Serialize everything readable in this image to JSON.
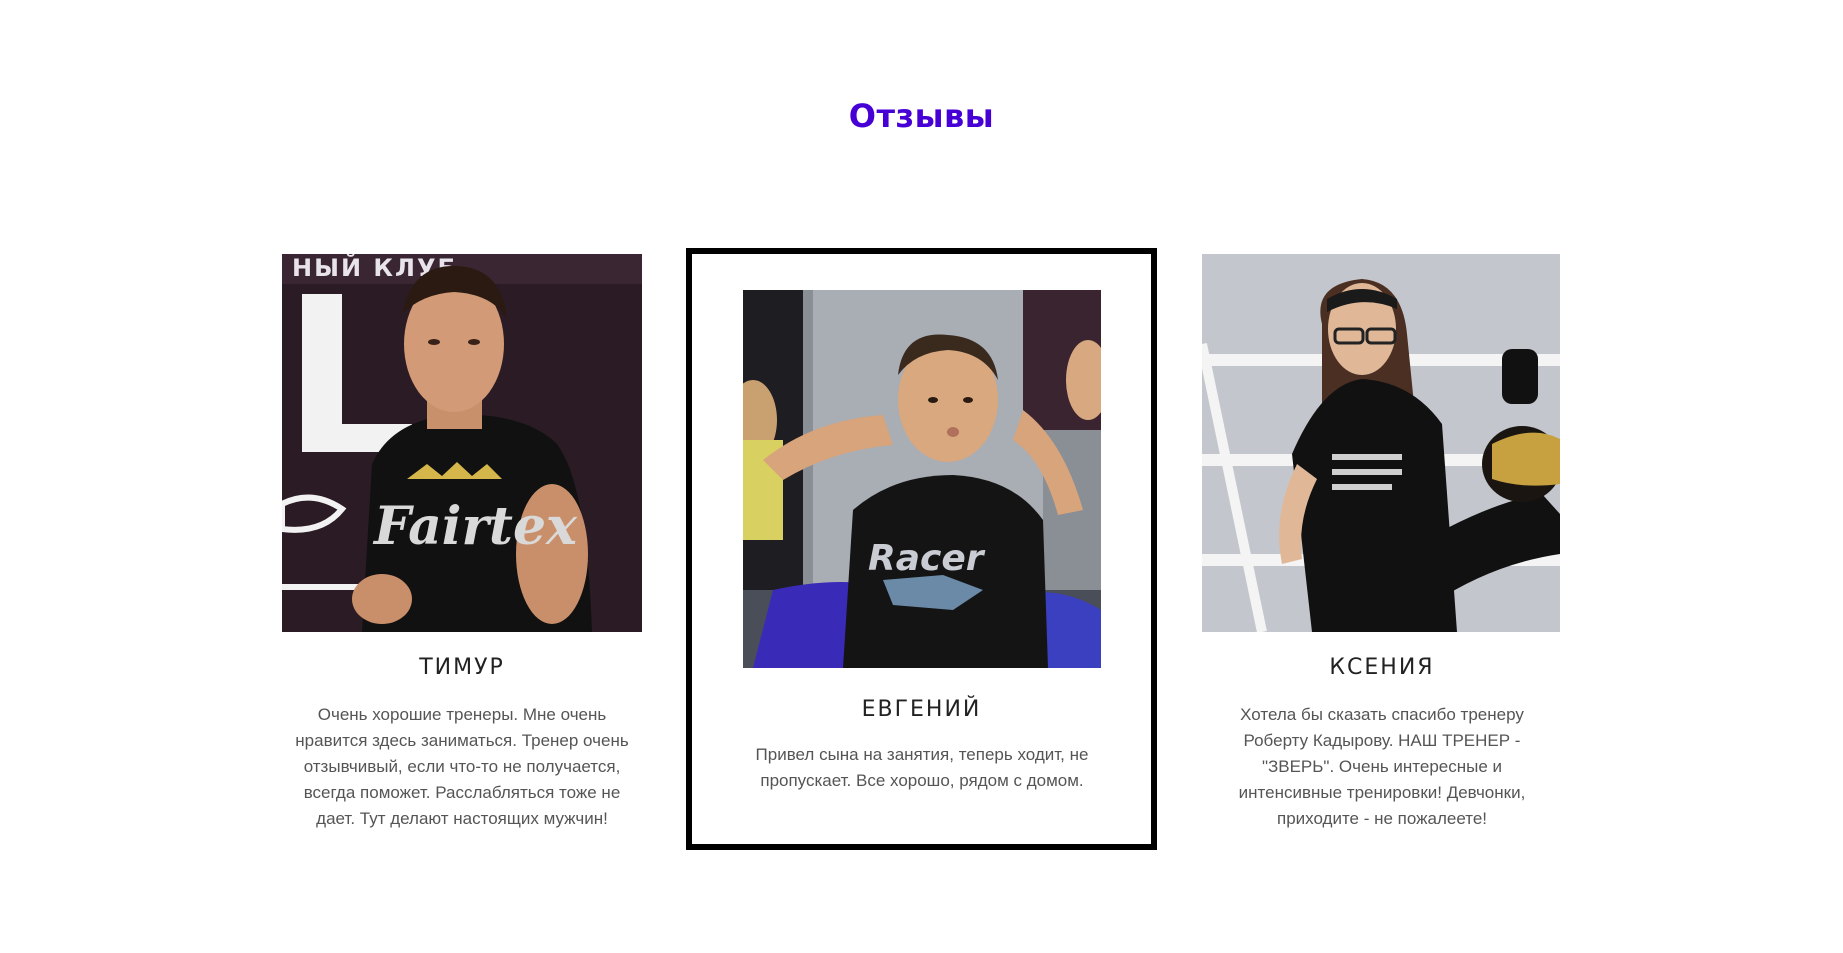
{
  "section": {
    "title": "Отзывы"
  },
  "reviews": [
    {
      "name": "ТИМУР",
      "text": "Очень хорошие тренеры. Мне очень нравится здесь заниматься. Тренер очень отзывчивый, если что-то не получается, всегда поможет. Расслабляться тоже не дает. Тут делают настоящих мужчин!",
      "photo_caption_text": "НЫЙ КЛУБ",
      "shirt_text": "Fairtex"
    },
    {
      "name": "ЕВГЕНИЙ",
      "text": "Привел сына на занятия, теперь ходит, не пропускает. Все хорошо, рядом с домом.",
      "shirt_text": "Racer"
    },
    {
      "name": "КСЕНИЯ",
      "text": "Хотела бы сказать спасибо тренеру Роберту Кадырову. НАШ ТРЕНЕР - \"ЗВЕРЬ\". Очень интересные и интенсивные тренировки! Девчонки, приходите - не пожалеете!"
    }
  ],
  "colors": {
    "title": "#4600d6",
    "highlight_border": "#000000",
    "name": "#222222",
    "review_text": "#555555"
  }
}
